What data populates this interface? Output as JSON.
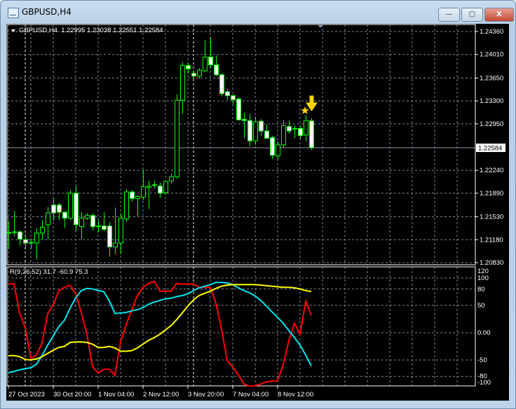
{
  "window": {
    "title": "GBPUSD,H4",
    "minimize": "—",
    "maximize": "▢",
    "close": "X"
  },
  "chart_header": {
    "symbol": "GBPUSD,H4",
    "open": "1.22995",
    "high": "1.23038",
    "low": "1.22551",
    "close": "1.22584"
  },
  "indicator_header": {
    "name": "R(9,26,52)",
    "values": [
      "31.7",
      "-60.9",
      "75.3"
    ]
  },
  "colors": {
    "bull": "#00ff00",
    "bear_body": "#ffffff",
    "red": "#ff0000",
    "cyan": "#00e5ee",
    "yellow": "#ffff00",
    "grid": "#7a8a9a"
  },
  "chart_data": [
    {
      "type": "candlestick",
      "ylim": [
        1.2083,
        1.2436
      ],
      "y_ticks": [
        "1.24360",
        "1.24010",
        "1.23650",
        "1.23300",
        "1.22950",
        "1.22240",
        "1.21890",
        "1.21530",
        "1.21180",
        "1.20830"
      ],
      "current_price": "1.22584",
      "x_labels": [
        "27 Oct 2023",
        "30 Oct 20:00",
        "1 Nov 04:00",
        "2 Nov 12:00",
        "3 Nov 20:00",
        "7 Nov 04:00",
        "8 Nov 12:00"
      ],
      "ohlc": [
        [
          1.2128,
          1.2147,
          1.2104,
          1.2129
        ],
        [
          1.2129,
          1.2162,
          1.2123,
          1.213
        ],
        [
          1.213,
          1.2132,
          1.2109,
          1.2119
        ],
        [
          1.2118,
          1.2123,
          1.2104,
          1.2113
        ],
        [
          1.2113,
          1.212,
          1.2104,
          1.2114
        ],
        [
          1.2113,
          1.2136,
          1.2088,
          1.2128
        ],
        [
          1.2128,
          1.2148,
          1.2118,
          1.2137
        ],
        [
          1.2141,
          1.2168,
          1.2118,
          1.2159
        ],
        [
          1.2171,
          1.2181,
          1.2147,
          1.2159
        ],
        [
          1.2171,
          1.2174,
          1.2148,
          1.216
        ],
        [
          1.216,
          1.2161,
          1.2136,
          1.2151
        ],
        [
          1.2151,
          1.2194,
          1.2148,
          1.2189
        ],
        [
          1.2189,
          1.22,
          1.2131,
          1.2141
        ],
        [
          1.2138,
          1.216,
          1.2118,
          1.2151
        ],
        [
          1.2151,
          1.2159,
          1.2148,
          1.2155
        ],
        [
          1.2155,
          1.2159,
          1.2132,
          1.2138
        ],
        [
          1.2138,
          1.2148,
          1.2129,
          1.2139
        ],
        [
          1.2139,
          1.216,
          1.2131,
          1.2134
        ],
        [
          1.2139,
          1.2145,
          1.2092,
          1.2107
        ],
        [
          1.2107,
          1.2167,
          1.2096,
          1.2113
        ],
        [
          1.2113,
          1.2158,
          1.2096,
          1.2151
        ],
        [
          1.215,
          1.2195,
          1.2145,
          1.2191
        ],
        [
          1.2191,
          1.2194,
          1.2176,
          1.2181
        ],
        [
          1.2181,
          1.2186,
          1.2154,
          1.2184
        ],
        [
          1.2183,
          1.2225,
          1.2178,
          1.2199
        ],
        [
          1.2198,
          1.2208,
          1.2165,
          1.22
        ],
        [
          1.2202,
          1.2208,
          1.2196,
          1.2201
        ],
        [
          1.22,
          1.2205,
          1.2182,
          1.2189
        ],
        [
          1.219,
          1.2207,
          1.2187,
          1.2207
        ],
        [
          1.2208,
          1.2219,
          1.2204,
          1.2214
        ],
        [
          1.2214,
          1.234,
          1.2211,
          1.2331
        ],
        [
          1.2331,
          1.2389,
          1.231,
          1.2384
        ],
        [
          1.2384,
          1.2388,
          1.2371,
          1.2379
        ],
        [
          1.2372,
          1.2376,
          1.2363,
          1.2368
        ],
        [
          1.2368,
          1.238,
          1.2364,
          1.2377
        ],
        [
          1.2376,
          1.2423,
          1.2374,
          1.2397
        ],
        [
          1.2397,
          1.2427,
          1.238,
          1.2385
        ],
        [
          1.2385,
          1.24,
          1.2368,
          1.237
        ],
        [
          1.237,
          1.2372,
          1.2337,
          1.2341
        ],
        [
          1.2344,
          1.2348,
          1.2332,
          1.2338
        ],
        [
          1.2338,
          1.234,
          1.2324,
          1.2332
        ],
        [
          1.2333,
          1.2335,
          1.23,
          1.2301
        ],
        [
          1.2302,
          1.2312,
          1.2273,
          1.23
        ],
        [
          1.23,
          1.2311,
          1.2261,
          1.2269
        ],
        [
          1.2269,
          1.2306,
          1.2263,
          1.2298
        ],
        [
          1.2299,
          1.2302,
          1.2277,
          1.2284
        ],
        [
          1.2284,
          1.2295,
          1.2272,
          1.2273
        ],
        [
          1.2274,
          1.2277,
          1.2241,
          1.2247
        ],
        [
          1.2246,
          1.2268,
          1.2241,
          1.2263
        ],
        [
          1.2263,
          1.23,
          1.2259,
          1.2292
        ],
        [
          1.2291,
          1.23,
          1.228,
          1.2284
        ],
        [
          1.2288,
          1.2292,
          1.2273,
          1.2288
        ],
        [
          1.2288,
          1.2292,
          1.2273,
          1.2277
        ],
        [
          1.2278,
          1.2308,
          1.2268,
          1.23
        ],
        [
          1.22995,
          1.23038,
          1.22551,
          1.22584
        ]
      ],
      "signals": [
        {
          "type": "down-arrow",
          "color": "#ffd700"
        },
        {
          "type": "star",
          "color": "#ffd700"
        }
      ]
    },
    {
      "type": "line",
      "ylim": [
        -100,
        120
      ],
      "y_ticks": [
        "120",
        "100",
        "80",
        "50",
        "0.00",
        "-50",
        "-80",
        "-100"
      ],
      "levels": [
        100,
        80,
        50,
        0,
        -50,
        -80
      ],
      "series": [
        {
          "color": "#ff0000",
          "values": [
            90,
            89,
            36,
            9,
            -47,
            -41,
            -19,
            35,
            51,
            77,
            83,
            87,
            71,
            37,
            -3,
            -62,
            -74,
            -67,
            -67,
            -78,
            -17,
            15,
            42,
            68,
            83,
            90,
            94,
            76,
            76,
            76,
            90,
            89,
            89,
            89,
            83,
            83,
            83,
            54,
            6,
            -51,
            -63,
            -77,
            -94,
            -98,
            -97,
            -94,
            -90,
            -89,
            -88,
            -58,
            -15,
            17,
            -3,
            58,
            31.7
          ]
        },
        {
          "color": "#00e5ee",
          "values": [
            -73,
            -71,
            -68,
            -66,
            -64,
            -58,
            -42,
            -23,
            -6,
            11,
            23,
            45,
            64,
            77,
            81,
            80,
            77,
            75,
            58,
            35,
            36,
            37,
            40,
            42,
            46,
            52,
            56,
            59,
            62,
            63,
            66,
            68,
            71,
            77,
            82,
            85,
            88,
            92,
            92,
            91,
            88,
            82,
            77,
            73,
            67,
            59,
            49,
            38,
            28,
            17,
            4,
            -9,
            -23,
            -41,
            -60.9
          ]
        },
        {
          "color": "#ffff00",
          "values": [
            -42,
            -42,
            -44,
            -49,
            -50,
            -48,
            -44,
            -38,
            -32,
            -27,
            -25,
            -18,
            -17,
            -17,
            -18,
            -21,
            -27,
            -27,
            -25,
            -28,
            -34,
            -34,
            -33,
            -28,
            -21,
            -14,
            -9,
            -3,
            5,
            13,
            24,
            36,
            49,
            60,
            68,
            72,
            76,
            81,
            85,
            87,
            88,
            88,
            88,
            88,
            88,
            87,
            86,
            85,
            84,
            83,
            83,
            82,
            80,
            77,
            75.3
          ]
        }
      ]
    }
  ]
}
